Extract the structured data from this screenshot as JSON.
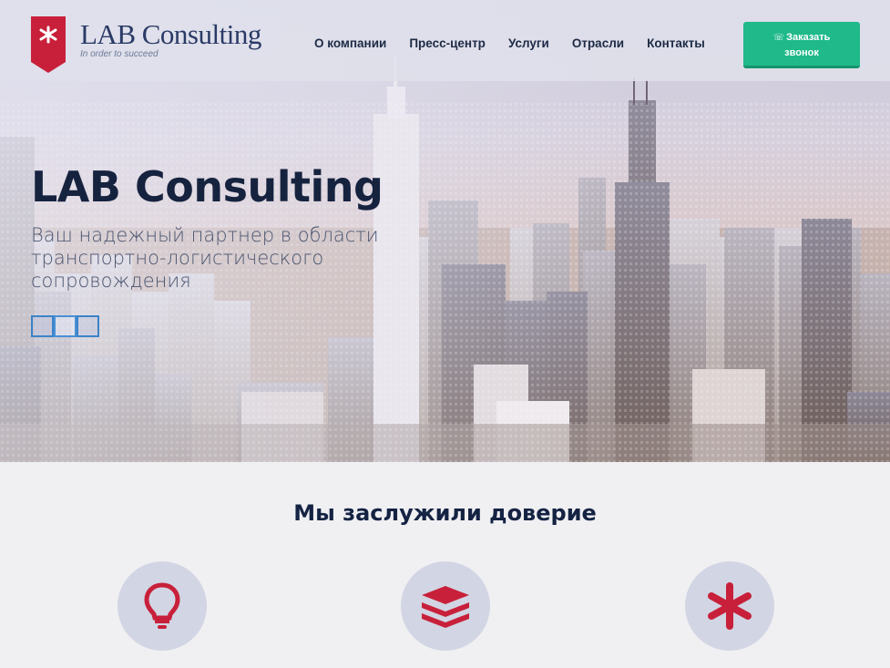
{
  "header": {
    "logo_title": "LAB Consulting",
    "logo_tagline": "In order to succeed",
    "nav": [
      "О компании",
      "Пресс-центр",
      "Услуги",
      "Отрасли",
      "Контакты"
    ],
    "cta_line1": "Заказать",
    "cta_line2": "звонок",
    "cta_icon": "phone-icon"
  },
  "hero": {
    "title": "LAB Consulting",
    "subtitle": "Ваш надежный партнер в области транспортно-логистического сопровождения",
    "slider_dots": 3,
    "active_dot": 1
  },
  "section": {
    "title": "Мы заслужили доверие",
    "features": [
      {
        "icon": "lightbulb-icon"
      },
      {
        "icon": "layers-icon"
      },
      {
        "icon": "asterisk-icon"
      }
    ]
  },
  "colors": {
    "accent_red": "#c8203a",
    "cta_green": "#1fb98a",
    "dark_text": "#16233f"
  }
}
